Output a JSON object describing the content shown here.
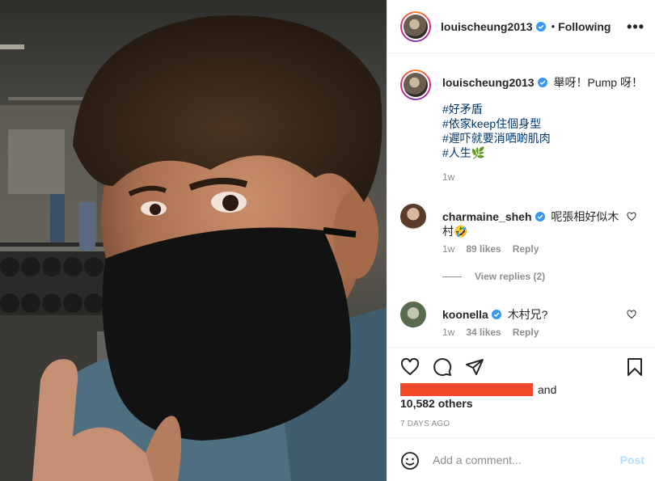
{
  "post": {
    "username": "louischeung2013",
    "separator": "•",
    "follow_status": "Following",
    "more_icon": "more-horizontal-icon",
    "verified_color": "#3897f0"
  },
  "caption": {
    "username": "louischeung2013",
    "text": "舉呀！Pump 呀！",
    "hashtags": [
      "#好矛盾",
      "#依家keep住個身型",
      "#遲吓就要消哂啲肌肉",
      "#人生🌿"
    ],
    "time": "1w"
  },
  "comments": [
    {
      "username": "charmaine_sheh",
      "text": "呢張相好似木村🤣",
      "time": "1w",
      "likes": "89 likes",
      "reply": "Reply"
    },
    {
      "username": "koonella",
      "text": "木村兄?",
      "time": "1w",
      "likes": "34 likes",
      "reply": "Reply"
    }
  ],
  "view_replies": "View replies (2)",
  "likes": {
    "and": "and",
    "others": "10,582 others"
  },
  "timestamp": "7 DAYS AGO",
  "comment_box": {
    "placeholder": "Add a comment...",
    "post_label": "Post"
  },
  "colors": {
    "link": "#00376b",
    "muted": "#8e8e8e",
    "border": "#efefef",
    "post_disabled": "#b2dffc",
    "redaction": "#f24a2a"
  }
}
